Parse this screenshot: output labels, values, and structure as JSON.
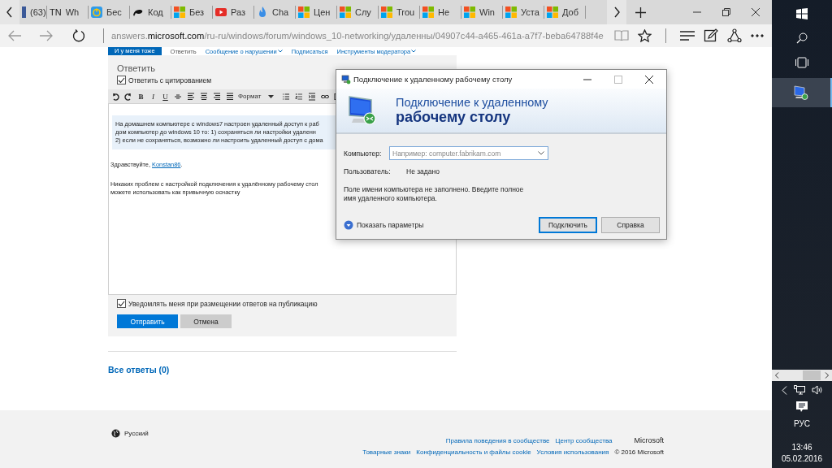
{
  "browser": {
    "tabs": [
      {
        "kind": "facebook",
        "title": "(63)"
      },
      {
        "kind": "tn",
        "badge": "TN",
        "title": "Wh"
      },
      {
        "kind": "power",
        "title": "Бес"
      },
      {
        "kind": "pen",
        "title": "Код"
      },
      {
        "kind": "windows",
        "title": "Без"
      },
      {
        "kind": "youtube",
        "title": "Раз"
      },
      {
        "kind": "flame",
        "title": "Cha"
      },
      {
        "kind": "windows",
        "title": "Цен"
      },
      {
        "kind": "windows",
        "title": "Слу"
      },
      {
        "kind": "windows",
        "title": "Trou"
      },
      {
        "kind": "windows",
        "title": "Не"
      },
      {
        "kind": "windows",
        "title": "Win"
      },
      {
        "kind": "windows",
        "title": "Уста"
      },
      {
        "kind": "windows",
        "title": "Доб"
      }
    ],
    "back_disabled": true,
    "forward_disabled": true,
    "reading_view_disabled": true,
    "url": {
      "prefix": "answers.",
      "host": "microsoft.com",
      "path": "/ru-ru/windows/forum/windows_10-networking/удаленны/04907c44-a465-461a-a7f7-beba64788f4e"
    }
  },
  "page": {
    "actions": [
      {
        "kind": "button",
        "label": "И у меня тоже"
      },
      {
        "kind": "plain",
        "label": "Ответить"
      },
      {
        "kind": "menu",
        "label": "Сообщение о нарушении"
      },
      {
        "kind": "link",
        "label": "Подписаться"
      },
      {
        "kind": "menu",
        "label": "Инструменты модератора"
      }
    ],
    "reply": {
      "title": "Ответить",
      "quote_option": {
        "label": "Ответить с цитированием",
        "checked": true
      },
      "toolbar": {
        "letters": [
          "B",
          "I",
          "U"
        ],
        "format": "Формат"
      },
      "quote_lines": [
        "На домашнем компьютере с windows7 настроен удаленный доступ к раб",
        "дом компьютер до windows 10 то: 1) сохраняться ли настройки удаленн",
        "2) если не сохраняться, возможно ли настроить удаленный доступ с дома"
      ],
      "greeting": "Здравствуйте, ",
      "user_link": "Konstan86",
      "greeting_end": ".",
      "body_lines": [
        "Никаких проблем с настройкой подключения к удалённому рабочему стол",
        "можете использовать как привычную оснастку"
      ],
      "notify_option": {
        "label": "Уведомлять меня при размещении ответов на публикацию",
        "checked": true
      },
      "submit": "Отправить",
      "cancel": "Отмена"
    },
    "all_answers": "Все ответы (0)",
    "footer": {
      "language": "Русский",
      "links_row1": [
        "Правила поведения в сообществе",
        "Центр сообщества"
      ],
      "brand": "Microsoft",
      "links_row2": [
        "Товарные знаки",
        "Конфиденциальность и файлы cookie",
        "Условия использования"
      ],
      "copyright": "© 2016 Microsoft"
    }
  },
  "dialog": {
    "title": "Подключение к удаленному рабочему столу",
    "controls": [
      {
        "kind": "minimize",
        "disabled": false
      },
      {
        "kind": "maximize",
        "disabled": true
      },
      {
        "kind": "close",
        "disabled": false
      }
    ],
    "heading_line1": "Подключение к удаленному",
    "heading_line2": "рабочему столу",
    "computer_label": "Компьютер:",
    "computer_placeholder": "Например: computer.fabrikam.com",
    "user_label": "Пользователь:",
    "user_value": "Не задано",
    "message": "Поле имени компьютера не заполнено. Введите полное имя удаленного компьютера.",
    "show_options": "Показать параметры",
    "buttons": [
      {
        "label": "Подключить",
        "focused": true
      },
      {
        "label": "Справка",
        "focused": false
      }
    ]
  },
  "taskbar": {
    "buttons": [
      {
        "kind": "start"
      },
      {
        "kind": "search"
      },
      {
        "kind": "taskview"
      }
    ],
    "apps": [
      {
        "kind": "remote-desktop",
        "selected": true
      }
    ],
    "language": "РУС",
    "time": "13:46",
    "date": "05.02.2016"
  }
}
